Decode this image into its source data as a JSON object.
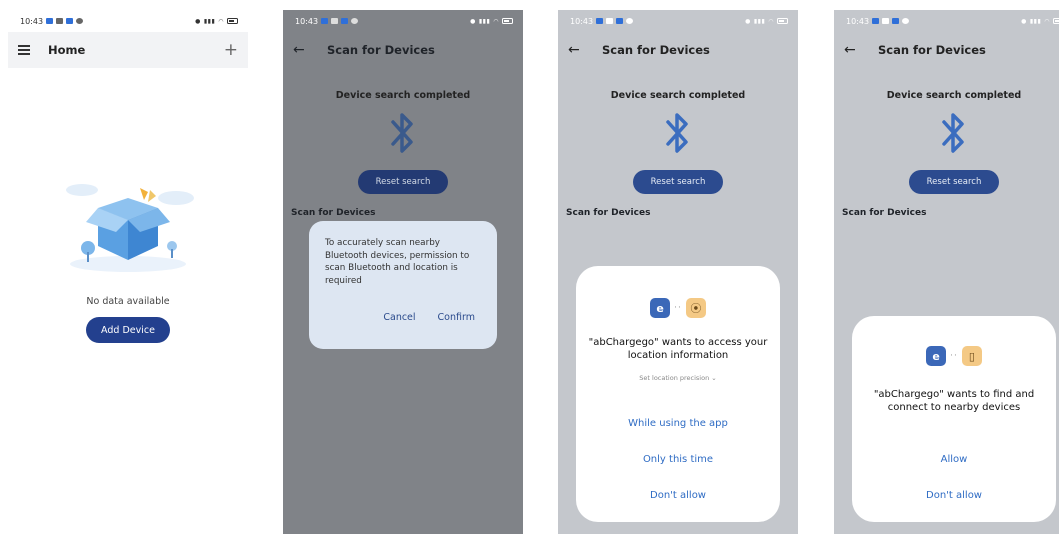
{
  "status_time": "10:43",
  "screen1": {
    "title": "Home",
    "plus_symbol": "+",
    "empty_text": "No data available",
    "add_button": "Add Device"
  },
  "scan": {
    "title": "Scan for Devices",
    "search_done": "Device search completed",
    "reset_button": "Reset search",
    "section_label": "Scan for Devices"
  },
  "screen2": {
    "dialog_message": "To accurately scan nearby Bluetooth devices, permission to scan Bluetooth and location is required",
    "cancel": "Cancel",
    "confirm": "Confirm"
  },
  "screen3": {
    "title": "\"abChargego\" wants to access your location information",
    "precision": "Set location precision ⌄",
    "option_while": "While using the app",
    "option_once": "Only this time",
    "option_deny": "Don't allow"
  },
  "screen4": {
    "title": "\"abChargego\" wants to find and connect to nearby devices",
    "option_allow": "Allow",
    "option_deny": "Don't allow"
  },
  "colors": {
    "primary_button": "#23408e",
    "bluetooth": "#3b6dbf",
    "link_blue": "#2f6cc4"
  }
}
